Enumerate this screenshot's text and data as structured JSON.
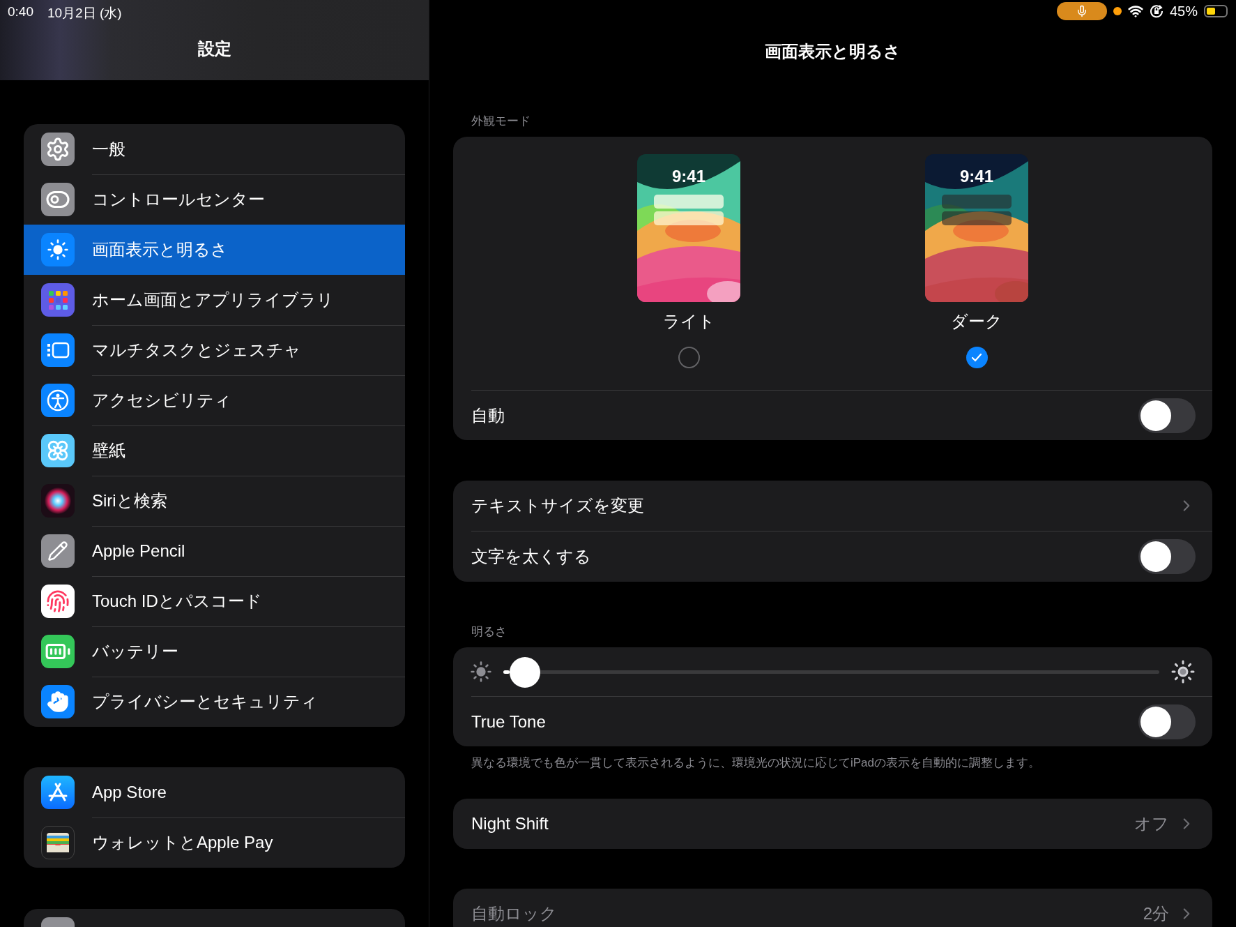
{
  "status_bar": {
    "time": "0:40",
    "date": "10月2日 (水)",
    "battery": "45%"
  },
  "sidebar": {
    "title": "設定",
    "groups": [
      {
        "items": [
          {
            "label": "一般",
            "selected": false
          },
          {
            "label": "コントロールセンター",
            "selected": false
          },
          {
            "label": "画面表示と明るさ",
            "selected": true
          },
          {
            "label": "ホーム画面とアプリライブラリ",
            "selected": false
          },
          {
            "label": "マルチタスクとジェスチャ",
            "selected": false
          },
          {
            "label": "アクセシビリティ",
            "selected": false
          },
          {
            "label": "壁紙",
            "selected": false
          },
          {
            "label": "Siriと検索",
            "selected": false
          },
          {
            "label": "Apple Pencil",
            "selected": false
          },
          {
            "label": "Touch IDとパスコード",
            "selected": false
          },
          {
            "label": "バッテリー",
            "selected": false
          },
          {
            "label": "プライバシーとセキュリティ",
            "selected": false
          }
        ]
      },
      {
        "items": [
          {
            "label": "App Store",
            "selected": false
          },
          {
            "label": "ウォレットとApple Pay",
            "selected": false
          }
        ]
      }
    ]
  },
  "detail": {
    "title": "画面表示と明るさ",
    "appearance": {
      "header": "外観モード",
      "options": [
        {
          "kind": "light",
          "label": "ライト",
          "time": "9:41",
          "selected": false
        },
        {
          "kind": "dark",
          "label": "ダーク",
          "time": "9:41",
          "selected": true
        }
      ],
      "auto": {
        "label": "自動",
        "on": false
      }
    },
    "text_rows": [
      {
        "kind": "link",
        "label": "テキストサイズを変更"
      },
      {
        "kind": "toggle",
        "label": "文字を太くする",
        "on": false
      }
    ],
    "brightness": {
      "header": "明るさ",
      "level": 0.01,
      "true_tone": {
        "label": "True Tone",
        "on": false
      },
      "footer": "異なる環境でも色が一貫して表示されるように、環境光の状況に応じてiPadの表示を自動的に調整します。"
    },
    "night_shift": {
      "label": "Night Shift",
      "value": "オフ"
    },
    "auto_lock": {
      "label": "自動ロック",
      "value": "2分",
      "disabled": true
    }
  }
}
